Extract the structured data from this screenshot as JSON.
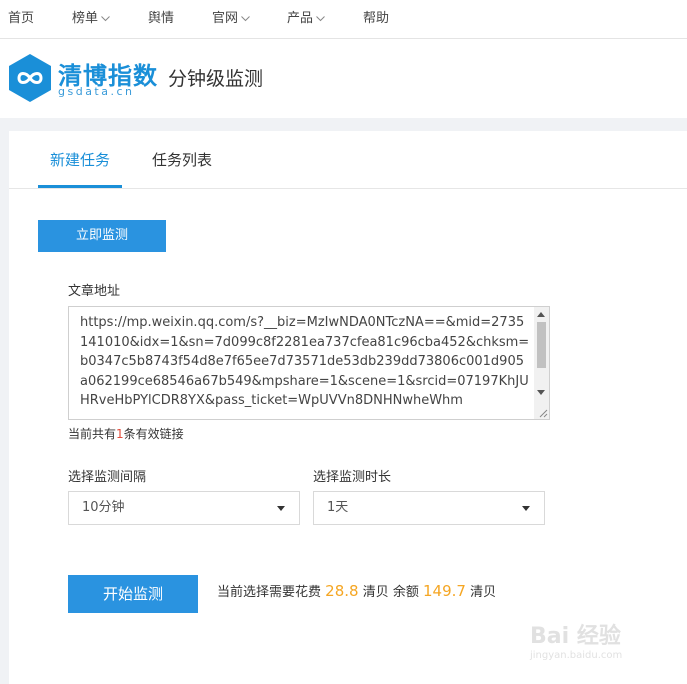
{
  "topnav": {
    "items": [
      {
        "label": "首页",
        "dropdown": false
      },
      {
        "label": "榜单",
        "dropdown": true
      },
      {
        "label": "舆情",
        "dropdown": false
      },
      {
        "label": "官网",
        "dropdown": true
      },
      {
        "label": "产品",
        "dropdown": true
      },
      {
        "label": "帮助",
        "dropdown": false
      }
    ]
  },
  "header": {
    "logo_text_a": "清博",
    "logo_text_b": "指数",
    "logo_domain": "gsdata.cn",
    "title": "分钟级监测"
  },
  "tabs": [
    {
      "label": "新建任务",
      "active": true
    },
    {
      "label": "任务列表",
      "active": false
    }
  ],
  "monitor_now_button": "立即监测",
  "form": {
    "url_label": "文章地址",
    "url_value": "https://mp.weixin.qq.com/s?__biz=MzIwNDA0NTczNA==&mid=2735141010&idx=1&sn=7d099c8f2281ea737cfea81c96cba452&chksm=b0347c5b8743f54d8e7f65ee7d73571de53db239dd73806c001d905a062199ce68546a67b549&mpshare=1&scene=1&srcid=07197KhJUHRveHbPYlCDR8YX&pass_ticket=WpUVVn8DNHNwheWhm",
    "count_prefix": "当前共有",
    "count_num": "1",
    "count_suffix": "条有效链接",
    "interval_label": "选择监测间隔",
    "interval_value": "10分钟",
    "duration_label": "选择监测时长",
    "duration_value": "1天",
    "start_button": "开始监测",
    "cost_prefix": "当前选择需要花费",
    "cost_amount": "28.8",
    "cost_unit1": "清贝",
    "balance_label": "余额",
    "balance_amount": "149.7",
    "cost_unit2": "清贝"
  },
  "watermark": {
    "text": "Bai 经验",
    "sub": "jingyan.baidu.com"
  },
  "colors": {
    "accent": "#1a8fd8",
    "button": "#2a93e0",
    "highlight_number": "#e24b3b",
    "amount": "#f5a623"
  }
}
